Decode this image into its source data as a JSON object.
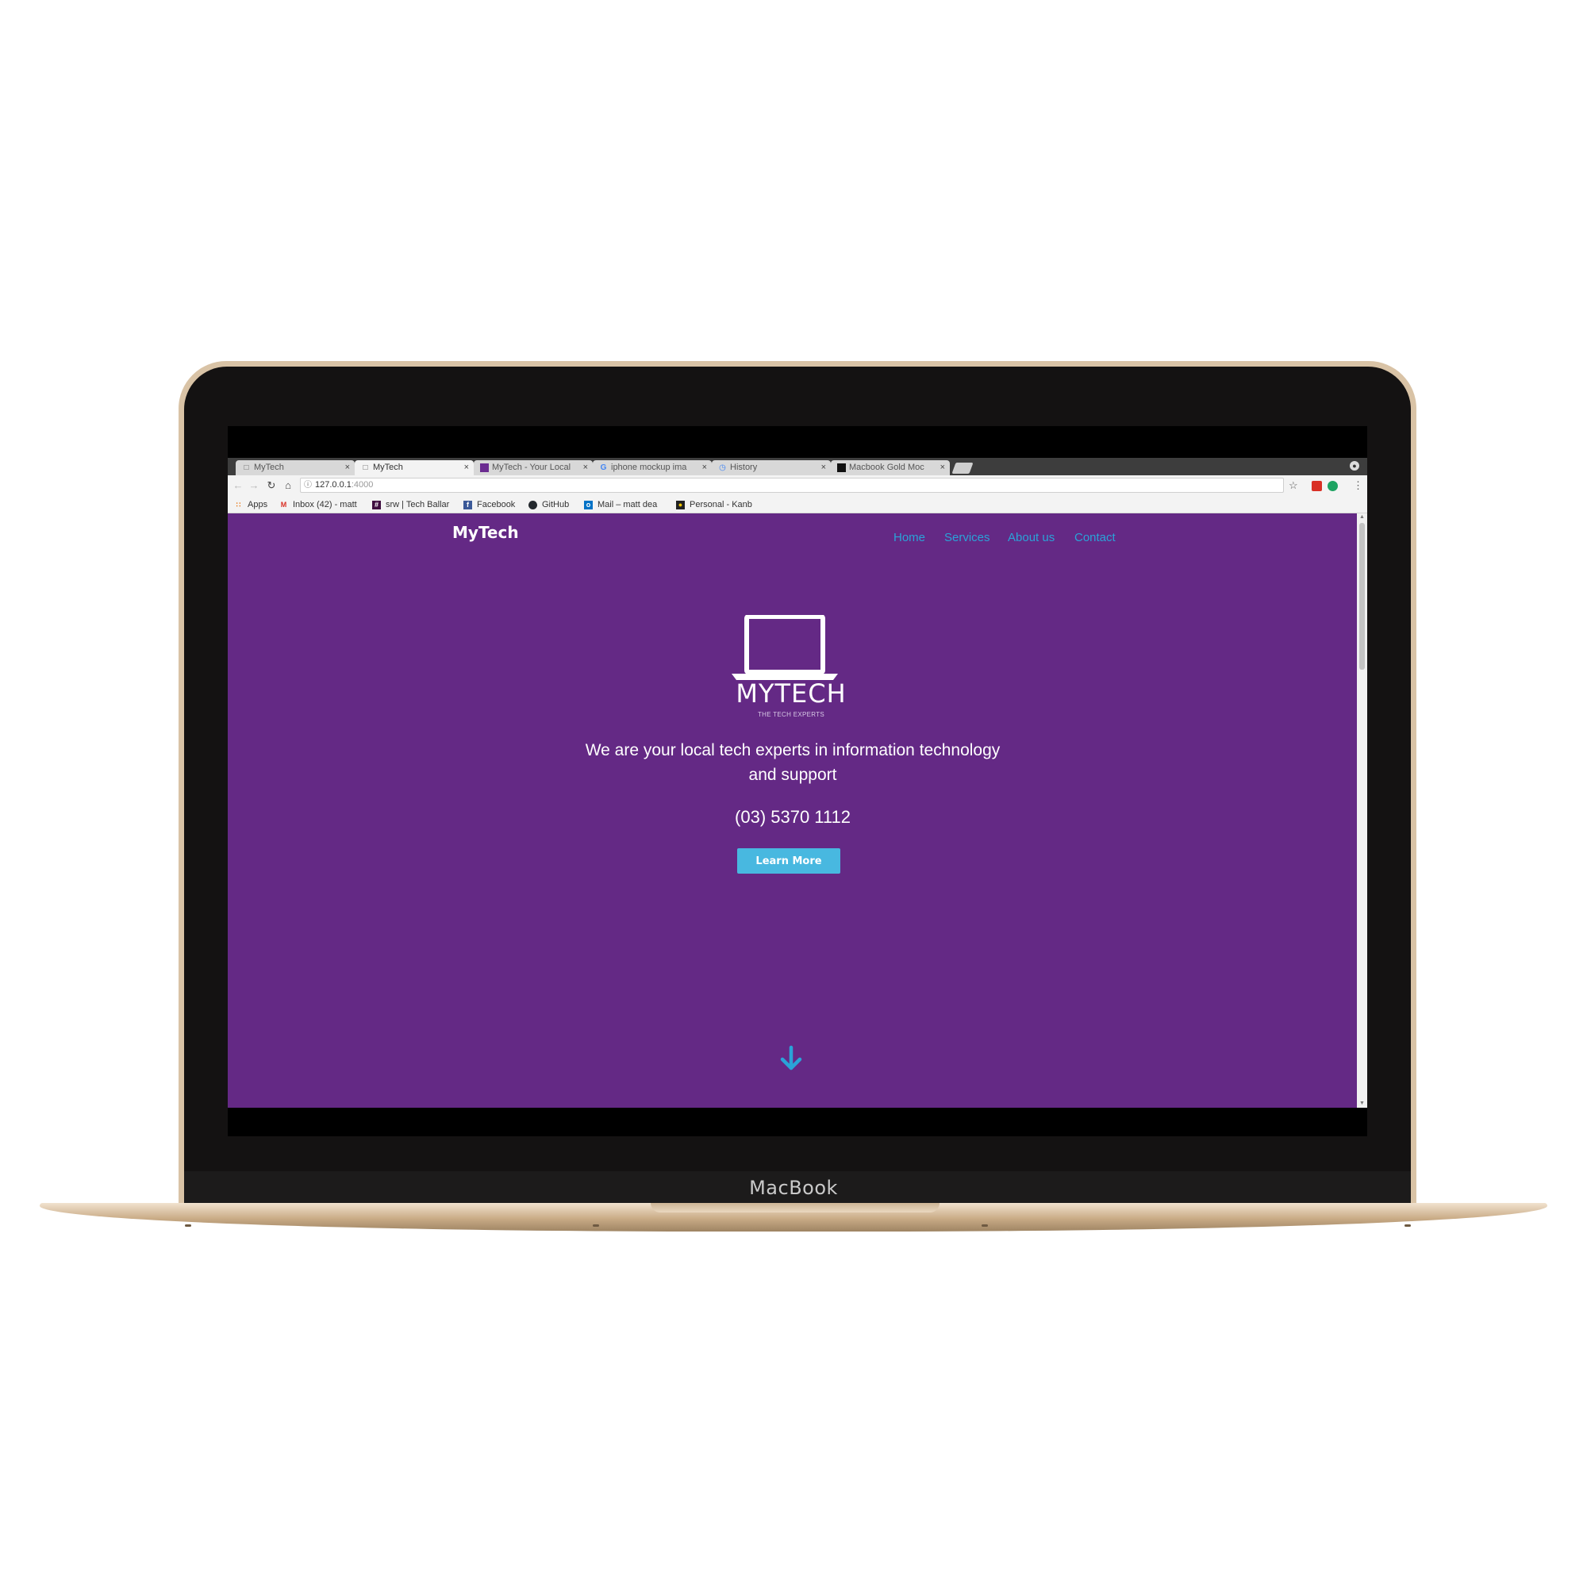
{
  "device": {
    "brand": "MacBook"
  },
  "browser": {
    "tabs": [
      {
        "label": "MyTech",
        "icon": "page-icon",
        "active": false
      },
      {
        "label": "MyTech",
        "icon": "page-icon",
        "active": true
      },
      {
        "label": "MyTech - Your Local",
        "icon": "site-favicon",
        "active": false
      },
      {
        "label": "iphone mockup ima",
        "icon": "google-icon",
        "active": false
      },
      {
        "label": "History",
        "icon": "history-icon",
        "active": false
      },
      {
        "label": "Macbook Gold Moc",
        "icon": "dark-favicon",
        "active": false
      }
    ],
    "close_glyph": "×",
    "url_host": "127.0.0.1",
    "url_port": ":4000",
    "bookmarks": [
      {
        "label": "Apps",
        "icon": "apps-grid-icon",
        "color": "#e8710a"
      },
      {
        "label": "Inbox (42) - matt",
        "icon": "gmail-icon",
        "color": "#d93025"
      },
      {
        "label": "srw | Tech Ballar",
        "icon": "slack-icon",
        "color": "#3f0e40"
      },
      {
        "label": "Facebook",
        "icon": "facebook-icon",
        "color": "#3b5998"
      },
      {
        "label": "GitHub",
        "icon": "github-icon",
        "color": "#24292e"
      },
      {
        "label": "Mail – matt dea",
        "icon": "outlook-icon",
        "color": "#0072c6"
      },
      {
        "label": "Personal - Kanb",
        "icon": "kanban-icon",
        "color": "#222222"
      }
    ]
  },
  "site": {
    "logo": "MyTech",
    "nav": [
      {
        "label": "Home"
      },
      {
        "label": "Services"
      },
      {
        "label": "About us"
      },
      {
        "label": "Contact"
      }
    ],
    "hero": {
      "brand_word": "MYTECH",
      "tagline": "THE TECH EXPERTS",
      "headline": "We are your local tech experts in information technology and support",
      "phone": "(03) 5370 1112",
      "cta_label": "Learn More"
    },
    "colors": {
      "background": "#642985",
      "link": "#2aa3d8",
      "button": "#48b8e0",
      "arrow": "#2aa3d8"
    }
  }
}
